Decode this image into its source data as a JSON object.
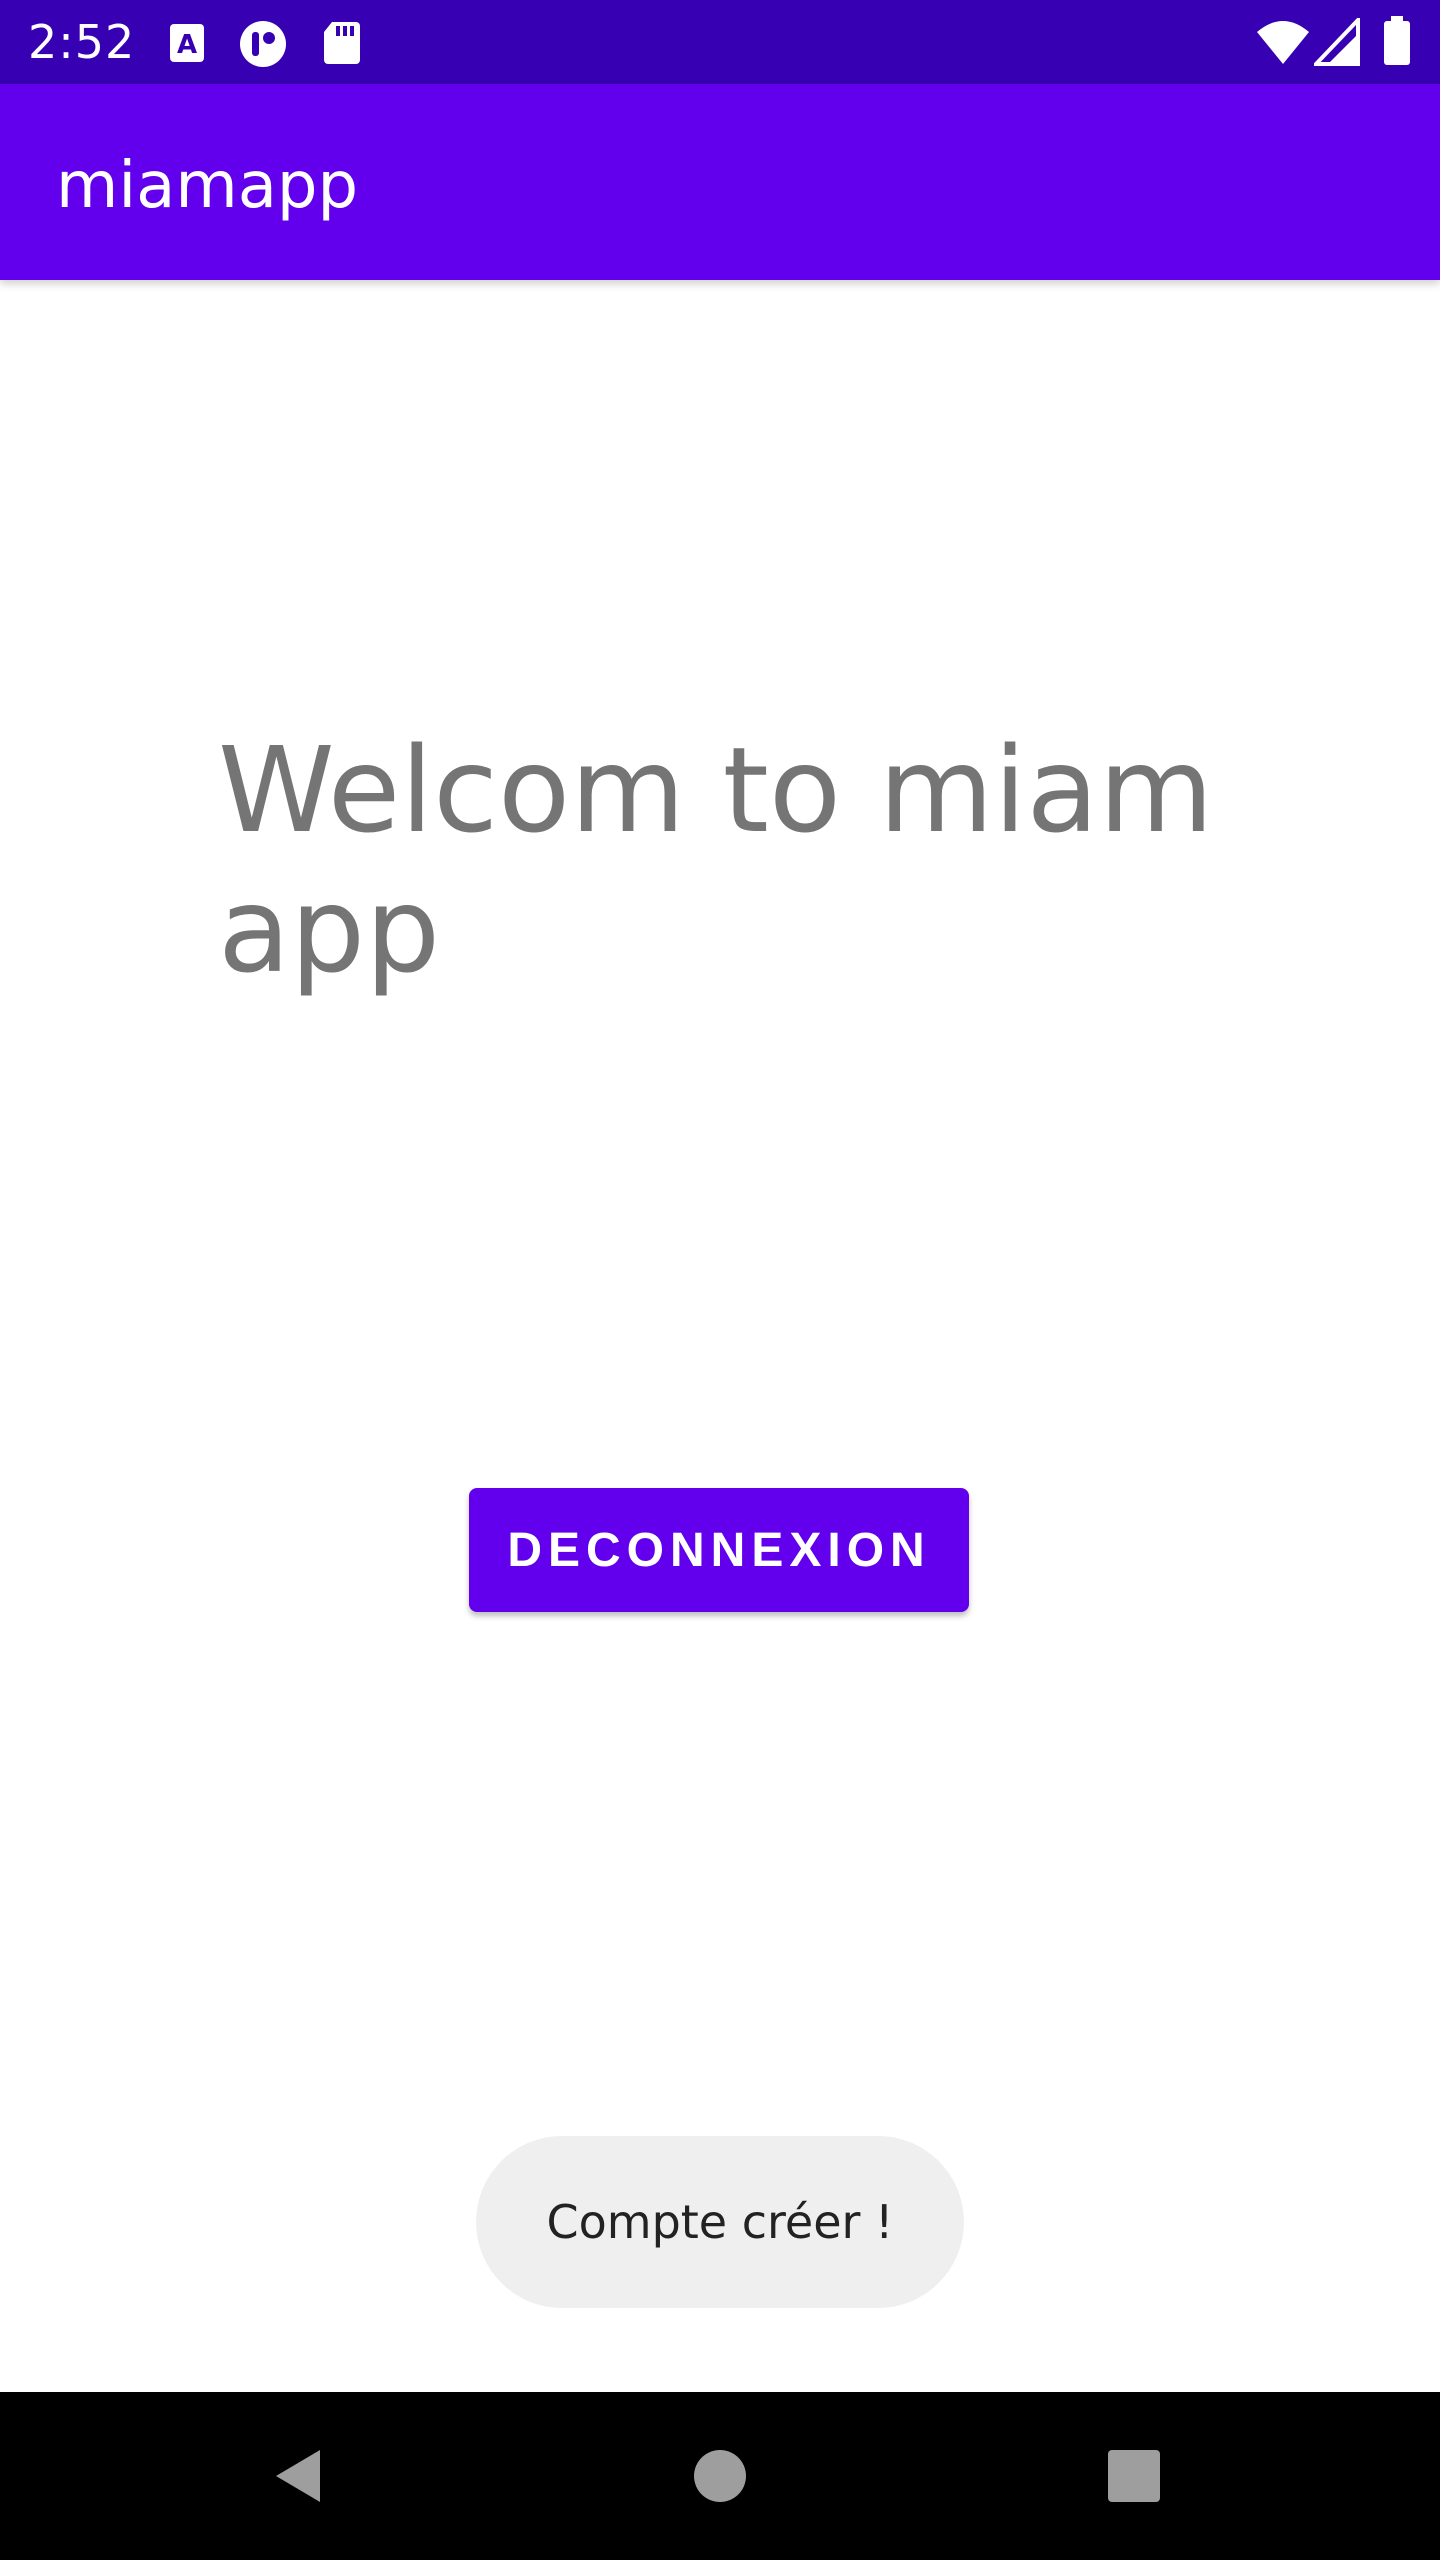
{
  "status_bar": {
    "time": "2:52",
    "icons_left": [
      "a-keyboard-icon",
      "notification-app-icon",
      "sd-card-icon"
    ],
    "icons_right": [
      "wifi-icon",
      "cell-signal-icon",
      "battery-icon"
    ],
    "background": "#3700b3"
  },
  "app_bar": {
    "title": "miamapp",
    "background": "#6200ee"
  },
  "main": {
    "welcome_text": "Welcom to miam app",
    "button_label": "DECONNEXION",
    "button_color": "#6200ee"
  },
  "toast": {
    "message": "Compte créer !"
  },
  "nav_bar": {
    "buttons": [
      "back-icon",
      "home-icon",
      "recents-icon"
    ]
  }
}
